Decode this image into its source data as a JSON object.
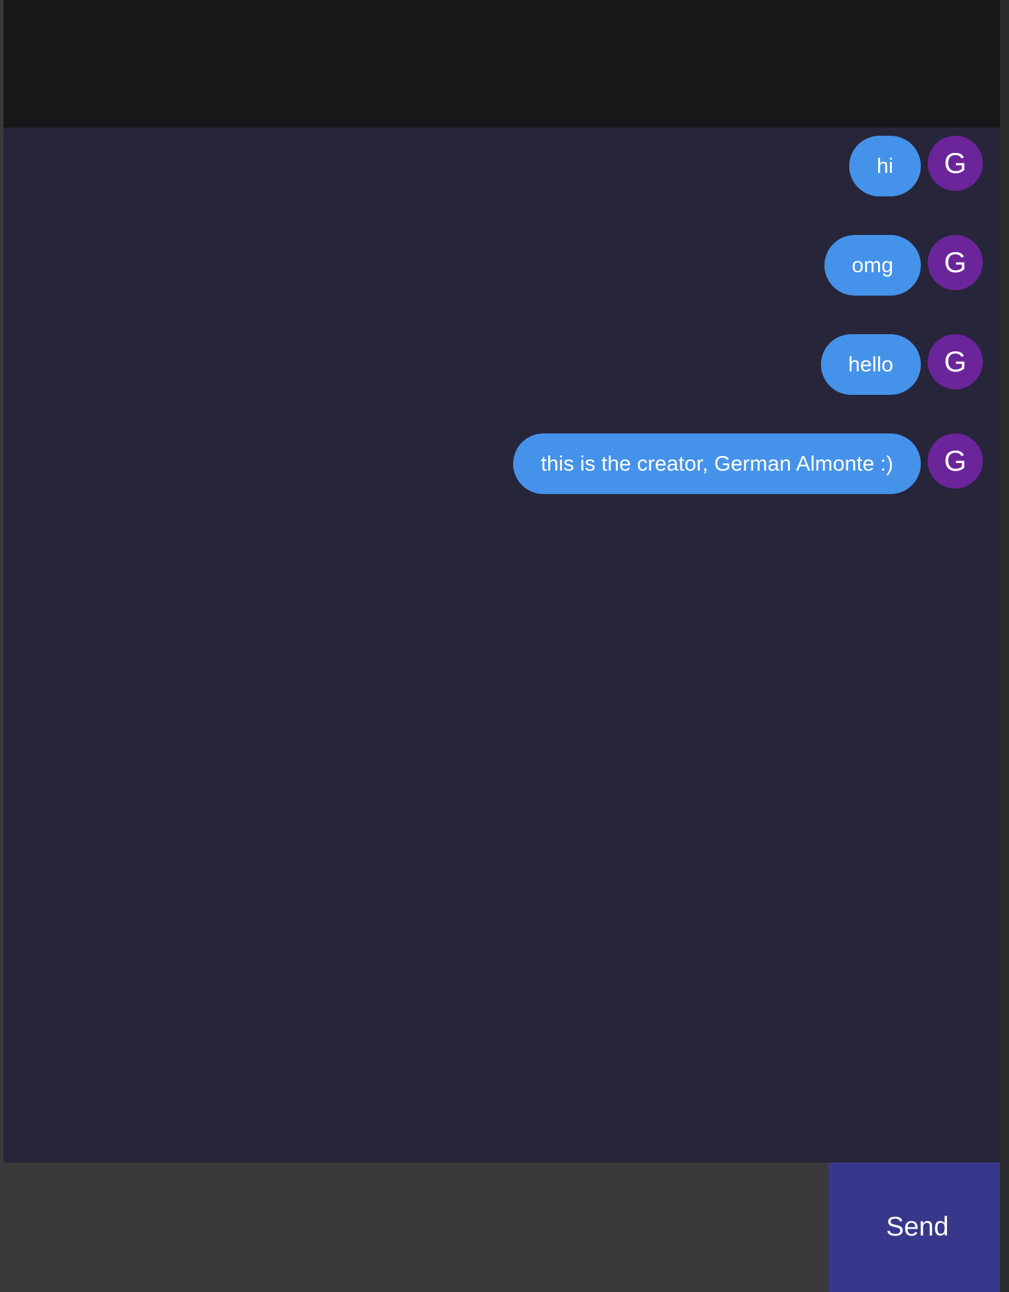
{
  "colors": {
    "app_background": "#27253a",
    "header_background": "#171719",
    "bubble_background": "#4592ea",
    "avatar_background": "#6c249a",
    "composer_background": "#3a3a3a",
    "send_button_background": "#37388b"
  },
  "messages": [
    {
      "text": "hi",
      "avatar": "G"
    },
    {
      "text": "omg",
      "avatar": "G"
    },
    {
      "text": "hello",
      "avatar": "G"
    },
    {
      "text": "this is the creator, German Almonte :)",
      "avatar": "G"
    }
  ],
  "composer": {
    "value": "",
    "placeholder": "",
    "send_label": "Send"
  }
}
